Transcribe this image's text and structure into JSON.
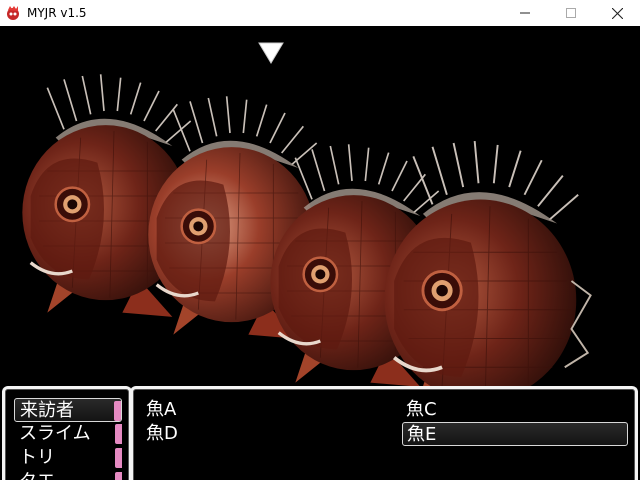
{
  "window": {
    "title": "MYJR v1.5",
    "minimize_icon": "minimize-icon",
    "maximize_icon": "maximize-icon",
    "close_icon": "close-icon"
  },
  "battle": {
    "target_cursor_icon": "down-triangle-icon",
    "enemy_sprite": "red-sea-bream-fish",
    "enemy_count_visible": 4
  },
  "party_window": {
    "items": [
      {
        "label": "来訪者",
        "selected": true
      },
      {
        "label": "スライム",
        "selected": false
      },
      {
        "label": "トリ",
        "selected": false
      },
      {
        "label": "タエ",
        "selected": false
      }
    ]
  },
  "enemy_window": {
    "items": [
      {
        "label": "魚A",
        "selected": false
      },
      {
        "label": "魚C",
        "selected": false
      },
      {
        "label": "魚D",
        "selected": false
      },
      {
        "label": "魚E",
        "selected": true
      }
    ]
  },
  "colors": {
    "window_border": "#f4f4f4",
    "background": "#000000",
    "fish_body": "#7a2a1c",
    "fish_highlight": "#c9745a",
    "scroll_marker": "#e58ac2"
  }
}
